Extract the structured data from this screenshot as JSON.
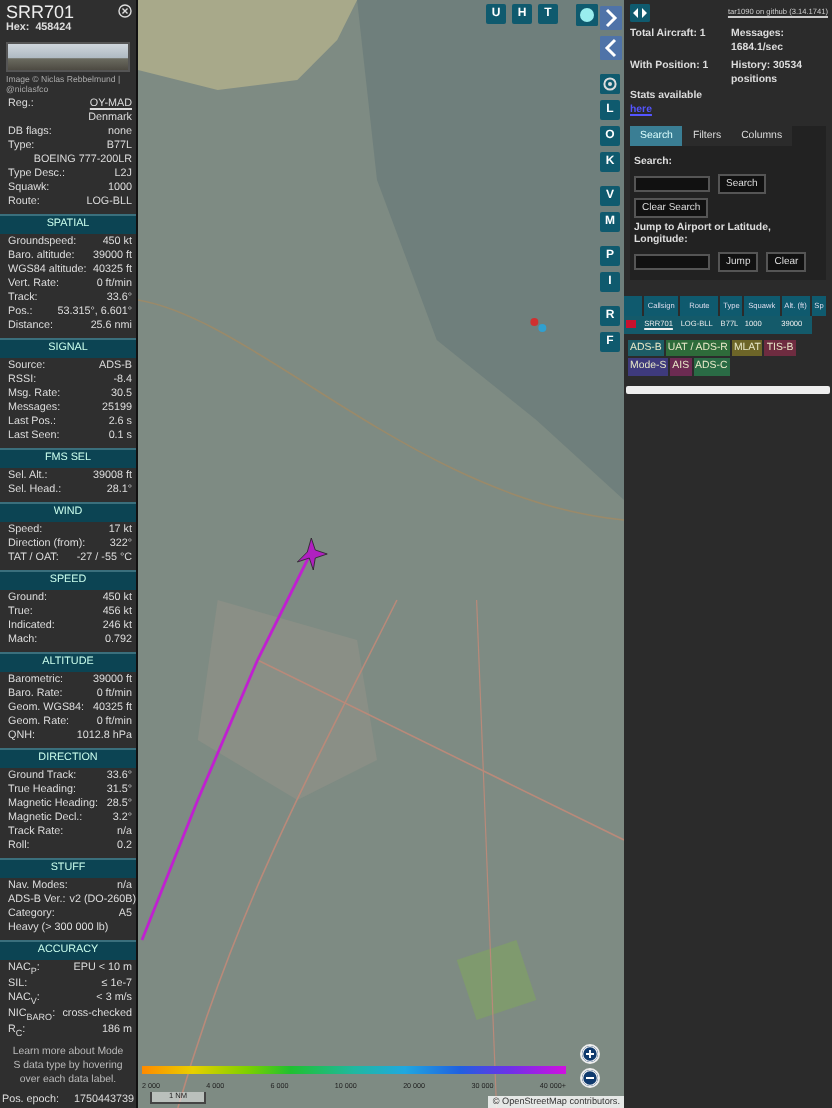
{
  "aircraft": {
    "callsign": "SRR701",
    "hex_label": "Hex:",
    "hex": "458424",
    "photo_credit": "Image © Niclas Rebbelmund | @niclasfco",
    "info_rows": [
      {
        "kind": "pair",
        "label": "Reg.:",
        "value": "OY-MAD",
        "link": true
      },
      {
        "kind": "value",
        "value": "Denmark"
      },
      {
        "kind": "pair",
        "label": "DB flags:",
        "value": "none"
      },
      {
        "kind": "pair",
        "label": "Type:",
        "value": "B77L"
      },
      {
        "kind": "value",
        "value": "BOEING 777-200LR"
      },
      {
        "kind": "pair",
        "label": "Type Desc.:",
        "value": "L2J"
      },
      {
        "kind": "pair",
        "label": "Squawk:",
        "value": "1000"
      },
      {
        "kind": "pair",
        "label": "Route:",
        "value": "LOG-BLL"
      }
    ],
    "sections": [
      {
        "title": "SPATIAL",
        "rows": [
          {
            "kind": "pair",
            "label": "Groundspeed:",
            "value": "450 kt"
          },
          {
            "kind": "pair",
            "label": "Baro. altitude:",
            "value": "39000 ft"
          },
          {
            "kind": "pair",
            "label": "WGS84 altitude:",
            "value": "40325 ft"
          },
          {
            "kind": "pair",
            "label": "Vert. Rate:",
            "value": "0 ft/min"
          },
          {
            "kind": "pair",
            "label": "Track:",
            "value": "33.6°"
          },
          {
            "kind": "pair",
            "label": "Pos.:",
            "value": "53.315°, 6.601°"
          },
          {
            "kind": "pair",
            "label": "Distance:",
            "value": "25.6 nmi"
          }
        ]
      },
      {
        "title": "SIGNAL",
        "rows": [
          {
            "kind": "pair",
            "label": "Source:",
            "value": "ADS-B"
          },
          {
            "kind": "pair",
            "label": "RSSI:",
            "value": "-8.4"
          },
          {
            "kind": "pair",
            "label": "Msg. Rate:",
            "value": "30.5"
          },
          {
            "kind": "pair",
            "label": "Messages:",
            "value": "25199"
          },
          {
            "kind": "pair",
            "label": "Last Pos.:",
            "value": "2.6 s"
          },
          {
            "kind": "pair",
            "label": "Last Seen:",
            "value": "0.1 s"
          }
        ]
      },
      {
        "title": "FMS SEL",
        "rows": [
          {
            "kind": "pair",
            "label": "Sel. Alt.:",
            "value": "39008 ft"
          },
          {
            "kind": "pair",
            "label": "Sel. Head.:",
            "value": "28.1°"
          }
        ]
      },
      {
        "title": "WIND",
        "rows": [
          {
            "kind": "pair",
            "label": "Speed:",
            "value": "17 kt"
          },
          {
            "kind": "pair",
            "label": "Direction (from):",
            "value": "322°"
          },
          {
            "kind": "pair",
            "label": "TAT / OAT:",
            "value": "-27 / -55 °C"
          }
        ]
      },
      {
        "title": "SPEED",
        "rows": [
          {
            "kind": "pair",
            "label": "Ground:",
            "value": "450 kt"
          },
          {
            "kind": "pair",
            "label": "True:",
            "value": "456 kt"
          },
          {
            "kind": "pair",
            "label": "Indicated:",
            "value": "246 kt"
          },
          {
            "kind": "pair",
            "label": "Mach:",
            "value": "0.792"
          }
        ]
      },
      {
        "title": "ALTITUDE",
        "rows": [
          {
            "kind": "pair",
            "label": "Barometric:",
            "value": "39000 ft"
          },
          {
            "kind": "pair",
            "label": "Baro. Rate:",
            "value": "0 ft/min"
          },
          {
            "kind": "pair",
            "label": "Geom. WGS84:",
            "value": "40325 ft"
          },
          {
            "kind": "pair",
            "label": "Geom. Rate:",
            "value": "0 ft/min"
          },
          {
            "kind": "pair",
            "label": "QNH:",
            "value": "1012.8 hPa"
          }
        ]
      },
      {
        "title": "DIRECTION",
        "rows": [
          {
            "kind": "pair",
            "label": "Ground Track:",
            "value": "33.6°"
          },
          {
            "kind": "pair",
            "label": "True Heading:",
            "value": "31.5°"
          },
          {
            "kind": "pair",
            "label": "Magnetic Heading:",
            "value": "28.5°"
          },
          {
            "kind": "pair",
            "label": "Magnetic Decl.:",
            "value": "3.2°"
          },
          {
            "kind": "pair",
            "label": "Track Rate:",
            "value": "n/a"
          },
          {
            "kind": "pair",
            "label": "Roll:",
            "value": "0.2"
          }
        ]
      },
      {
        "title": "STUFF",
        "rows": [
          {
            "kind": "pair",
            "label": "Nav. Modes:",
            "value": "n/a"
          },
          {
            "kind": "pair",
            "label": "ADS-B Ver.:",
            "value": "v2 (DO-260B)"
          },
          {
            "kind": "pair",
            "label": "Category:",
            "value": "A5"
          },
          {
            "kind": "label",
            "label": "Heavy (> 300 000 lb)"
          }
        ]
      },
      {
        "title": "ACCURACY",
        "rows": [
          {
            "kind": "pair",
            "label": "NAC$_{P}$:",
            "value": "EPU < 10 m"
          },
          {
            "kind": "pair",
            "label": "SIL:",
            "value": "≤ 1e-7"
          },
          {
            "kind": "pair",
            "label": "NAC$_{V}$:",
            "value": "< 3 m/s"
          },
          {
            "kind": "pair",
            "label": "NIC$_{BARO}$:",
            "value": "cross-checked"
          },
          {
            "kind": "pair",
            "label": "R$_{C}$:",
            "value": "186 m"
          }
        ]
      }
    ],
    "note": "Learn more about Mode S data type by hovering over each data label.",
    "epoch_label": "Pos. epoch:",
    "epoch": "1750443739"
  },
  "map": {
    "top_buttons": [
      "U",
      "H",
      "T"
    ],
    "side_buttons": [
      "L",
      "O",
      "K",
      "V",
      "M",
      "P",
      "I",
      "R",
      "F"
    ],
    "altitude_labels": [
      "2 000",
      "4 000",
      "6 000",
      "10 000",
      "20 000",
      "30 000",
      "40 000+"
    ],
    "scale": "1 NM",
    "attribution": "© OpenStreetMap contributors."
  },
  "sidebar": {
    "version_link": "tar1090 on github (3.14.1741)",
    "stats": [
      {
        "label": "Total Aircraft:",
        "value": "1"
      },
      {
        "label": "Messages:",
        "value": "1684.1/sec"
      },
      {
        "label": "With Position:",
        "value": "1"
      },
      {
        "label": "History:",
        "value": "30534 positions"
      }
    ],
    "stats_text": "Stats available",
    "stats_link": "here",
    "tabs": [
      {
        "label": "Search",
        "selected": true
      },
      {
        "label": "Filters",
        "selected": false
      },
      {
        "label": "Columns",
        "selected": false
      }
    ],
    "search_label": "Search:",
    "search_button": "Search",
    "clear_search_button": "Clear Search",
    "jump_label": "Jump to Airport or Latitude, Longitude:",
    "jump_button": "Jump",
    "clear_button": "Clear",
    "table": {
      "columns": [
        "Callsign",
        "Route",
        "Type",
        "Squawk",
        "Alt. (ft)",
        "Sp"
      ],
      "rows": [
        {
          "cells": [
            "SRR701",
            "LOG-BLL",
            "B77L",
            "1000",
            "39000"
          ]
        }
      ]
    },
    "legend": [
      {
        "label": "ADS-B",
        "color": "#1d5c66"
      },
      {
        "label": "UAT / ADS-R",
        "color": "#2e6b3a"
      },
      {
        "label": "MLAT",
        "color": "#6d6528"
      },
      {
        "label": "TIS-B",
        "color": "#6e2c40"
      },
      {
        "label": "Mode-S",
        "color": "#3e3a7c"
      },
      {
        "label": "AIS",
        "color": "#6c2b52"
      },
      {
        "label": "ADS-C",
        "color": "#2a6b45"
      }
    ]
  }
}
